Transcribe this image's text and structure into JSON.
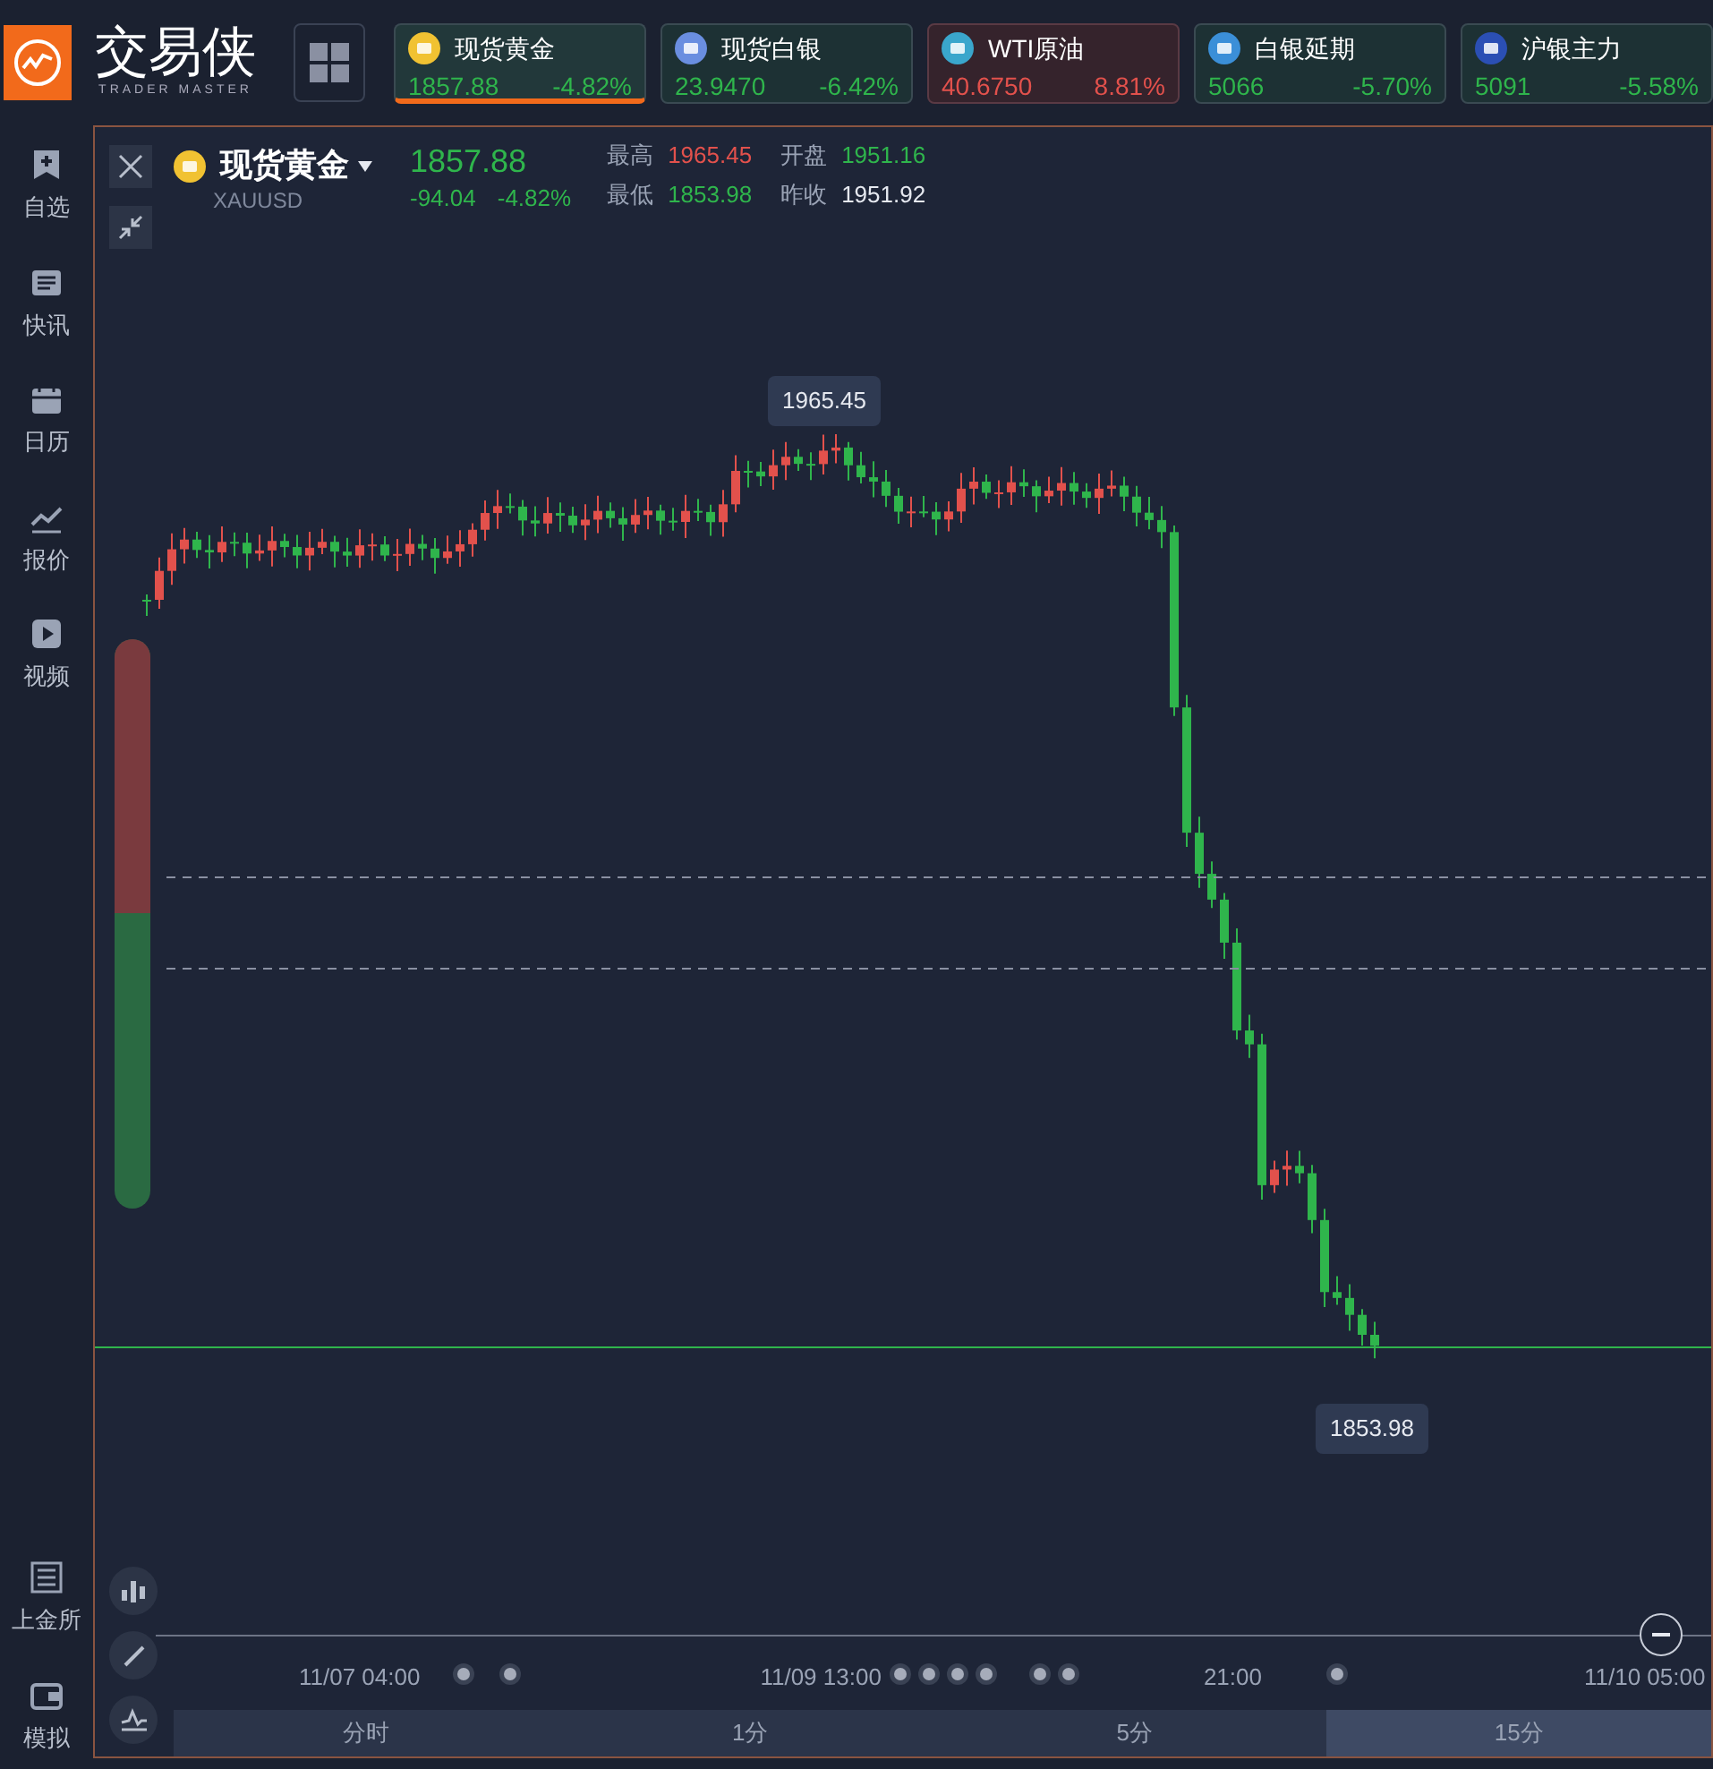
{
  "app": {
    "name": "交易侠",
    "tagline": "TRADER MASTER"
  },
  "tickers": [
    {
      "kind": "gold",
      "name": "现货黄金",
      "price": "1857.88",
      "change": "-4.82%",
      "rising": false,
      "selected": true
    },
    {
      "kind": "silver",
      "name": "现货白银",
      "price": "23.9470",
      "change": "-6.42%",
      "rising": false,
      "selected": false
    },
    {
      "kind": "oil",
      "name": "WTI原油",
      "price": "40.6750",
      "change": "8.81%",
      "rising": true,
      "selected": false
    },
    {
      "kind": "deferred",
      "name": "白银延期",
      "price": "5066",
      "change": "-5.70%",
      "rising": false,
      "selected": false
    },
    {
      "kind": "exchange",
      "name": "沪银主力",
      "price": "5091",
      "change": "-5.58%",
      "rising": false,
      "selected": false
    }
  ],
  "sidebar": {
    "items": [
      {
        "kind": "watchlist",
        "label": "自选"
      },
      {
        "kind": "news",
        "label": "快讯"
      },
      {
        "kind": "calendar",
        "label": "日历"
      },
      {
        "kind": "quotes",
        "label": "报价"
      },
      {
        "kind": "video",
        "label": "视频"
      }
    ],
    "bottom_items": [
      {
        "kind": "sge",
        "label": "上金所"
      },
      {
        "kind": "wallet",
        "label": "模拟"
      }
    ]
  },
  "instrument": {
    "name": "现货黄金",
    "code": "XAUUSD",
    "price": "1857.88",
    "change": "-94.04",
    "change_pct": "-4.82%",
    "rising": false,
    "stats": [
      {
        "label": "最高",
        "value": "1965.45",
        "color": "#e2514c"
      },
      {
        "label": "开盘",
        "value": "1951.16",
        "color": "#2fb54c"
      },
      {
        "label": "最低",
        "value": "1853.98",
        "color": "#2fb54c"
      },
      {
        "label": "昨收",
        "value": "1951.92",
        "color": "#e6e9f0"
      }
    ]
  },
  "chart": {
    "high_label": "1965.45",
    "low_label": "1853.98",
    "sentiment_bar": {
      "level": 0.48
    },
    "time_labels": [
      "11/07 04:00",
      "11/09 13:00",
      "21:00",
      "11/10 05:00"
    ]
  },
  "timeframes": [
    {
      "label": "分时",
      "selected": false
    },
    {
      "label": "1分",
      "selected": false
    },
    {
      "label": "5分",
      "selected": false
    },
    {
      "label": "15分",
      "selected": true
    }
  ]
}
